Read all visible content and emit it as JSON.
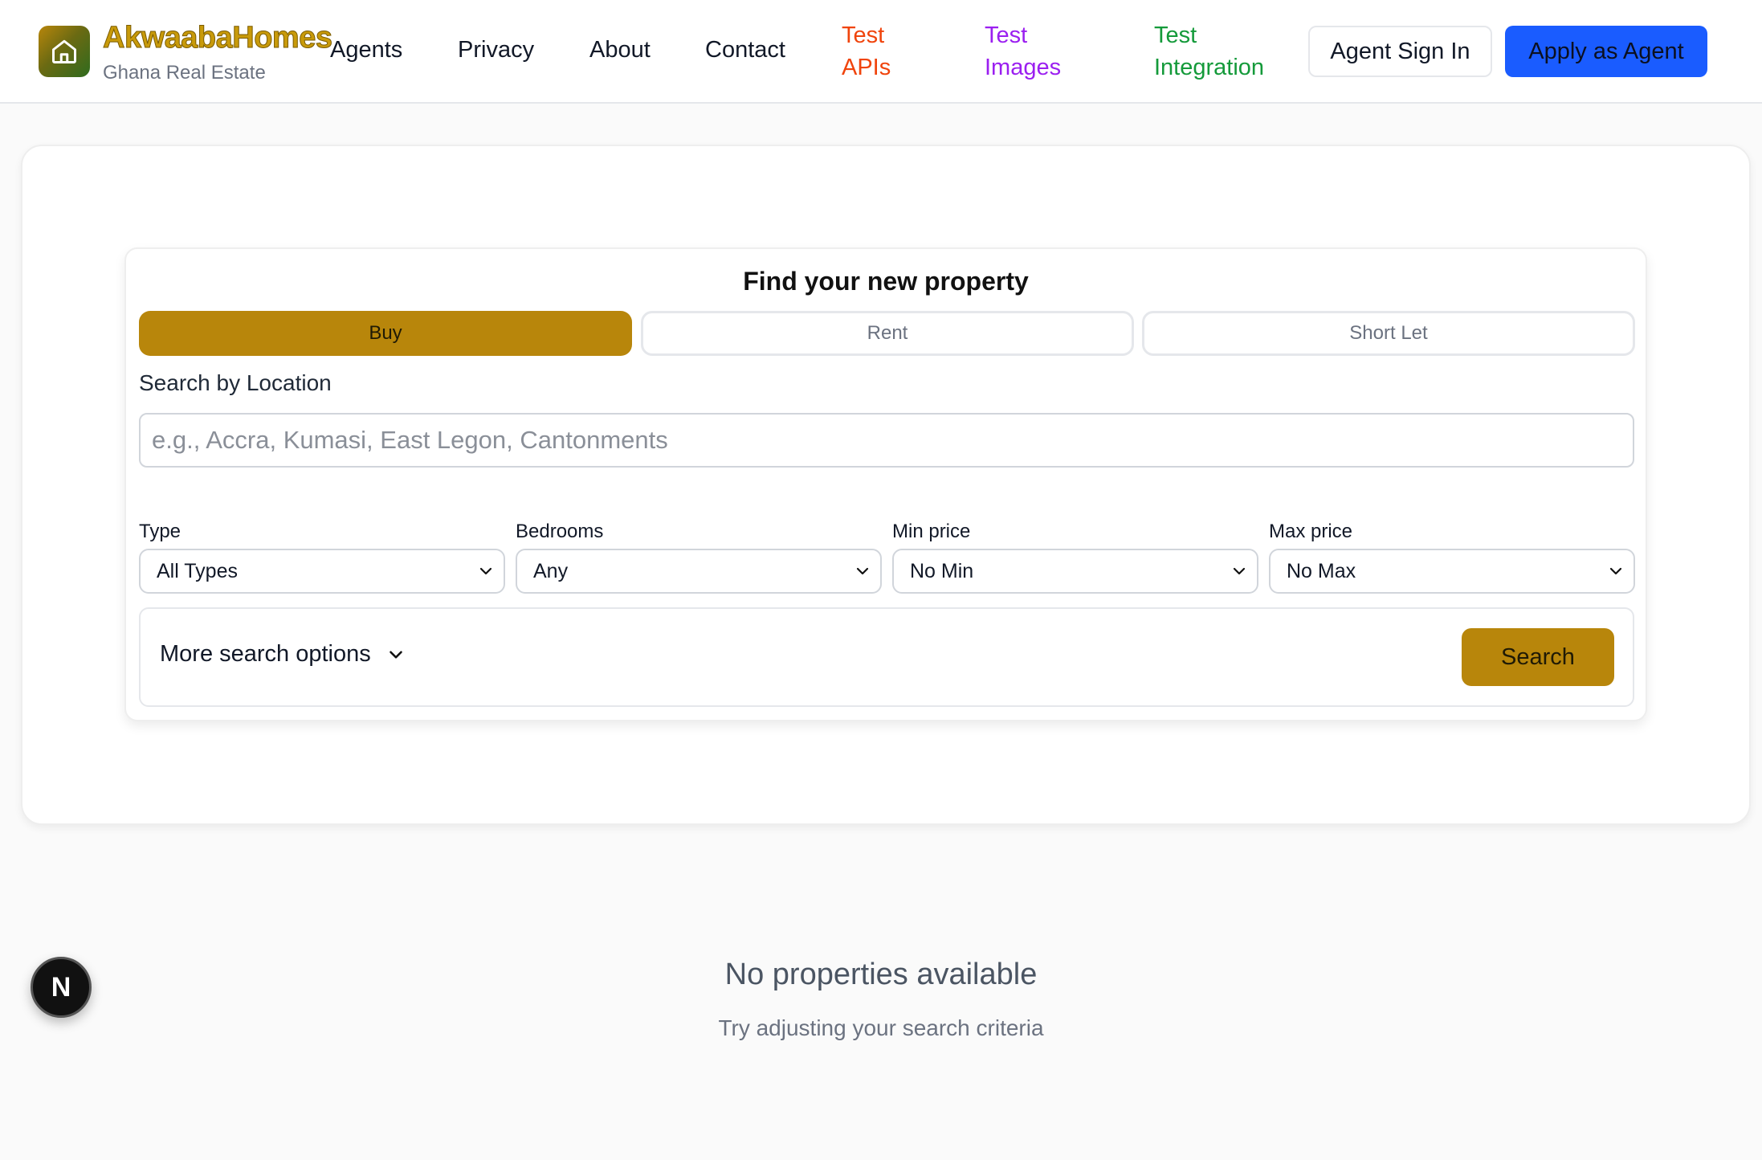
{
  "brand": {
    "name": "AkwaabaHomes",
    "tagline": "Ghana Real Estate",
    "logo_icon": "home-icon"
  },
  "nav": {
    "agents": "Agents",
    "privacy": "Privacy",
    "about": "About",
    "contact": "Contact",
    "test_apis": {
      "line1": "Test",
      "line2": "APIs",
      "color": "#f0440c"
    },
    "test_images": {
      "line1": "Test",
      "line2": "Images",
      "color": "#9b1ff0"
    },
    "test_integration": {
      "line1": "Test",
      "line2": "Integration",
      "color": "#149a3a"
    },
    "sign_in": "Agent Sign In",
    "apply": "Apply as Agent"
  },
  "search": {
    "title": "Find your new property",
    "tabs": [
      {
        "label": "Buy",
        "active": true
      },
      {
        "label": "Rent",
        "active": false
      },
      {
        "label": "Short Let",
        "active": false
      }
    ],
    "location_label": "Search by Location",
    "location_placeholder": "e.g., Accra, Kumasi, East Legon, Cantonments",
    "location_value": "",
    "filters": [
      {
        "label": "Type",
        "value": "All Types"
      },
      {
        "label": "Bedrooms",
        "value": "Any"
      },
      {
        "label": "Min price",
        "value": "No Min"
      },
      {
        "label": "Max price",
        "value": "No Max"
      }
    ],
    "more_options": "More search options",
    "search_button": "Search"
  },
  "results": {
    "empty_title": "No properties available",
    "empty_subtitle": "Try adjusting your search criteria"
  },
  "dev_badge": {
    "letter": "N"
  },
  "colors": {
    "accent_gold": "#b8860b",
    "primary_blue": "#1a5cff"
  }
}
